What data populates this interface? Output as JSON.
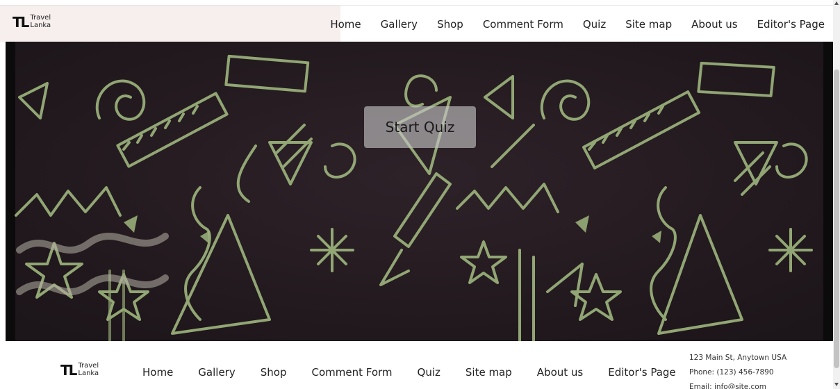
{
  "header": {
    "logo": {
      "mark": "TL",
      "line1": "Travel",
      "line2": "Lanka"
    },
    "nav": [
      "Home",
      "Gallery",
      "Shop",
      "Comment Form",
      "Quiz",
      "Site map",
      "About us",
      "Editor's Page"
    ]
  },
  "hero": {
    "button_label": "Start Quiz"
  },
  "footer": {
    "logo": {
      "mark": "TL",
      "line1": "Travel",
      "line2": "Lanka"
    },
    "nav": [
      "Home",
      "Gallery",
      "Shop",
      "Comment Form",
      "Quiz",
      "Site map",
      "About us",
      "Editor's Page"
    ],
    "contact": {
      "address": "123 Main St, Anytown USA",
      "phone": "Phone: (123) 456-7890",
      "email": "Email: info@site.com"
    }
  },
  "colors": {
    "brand_tint": "#f7eeee",
    "hero_bg": "#241a20",
    "doodle": "#9fb77e"
  }
}
